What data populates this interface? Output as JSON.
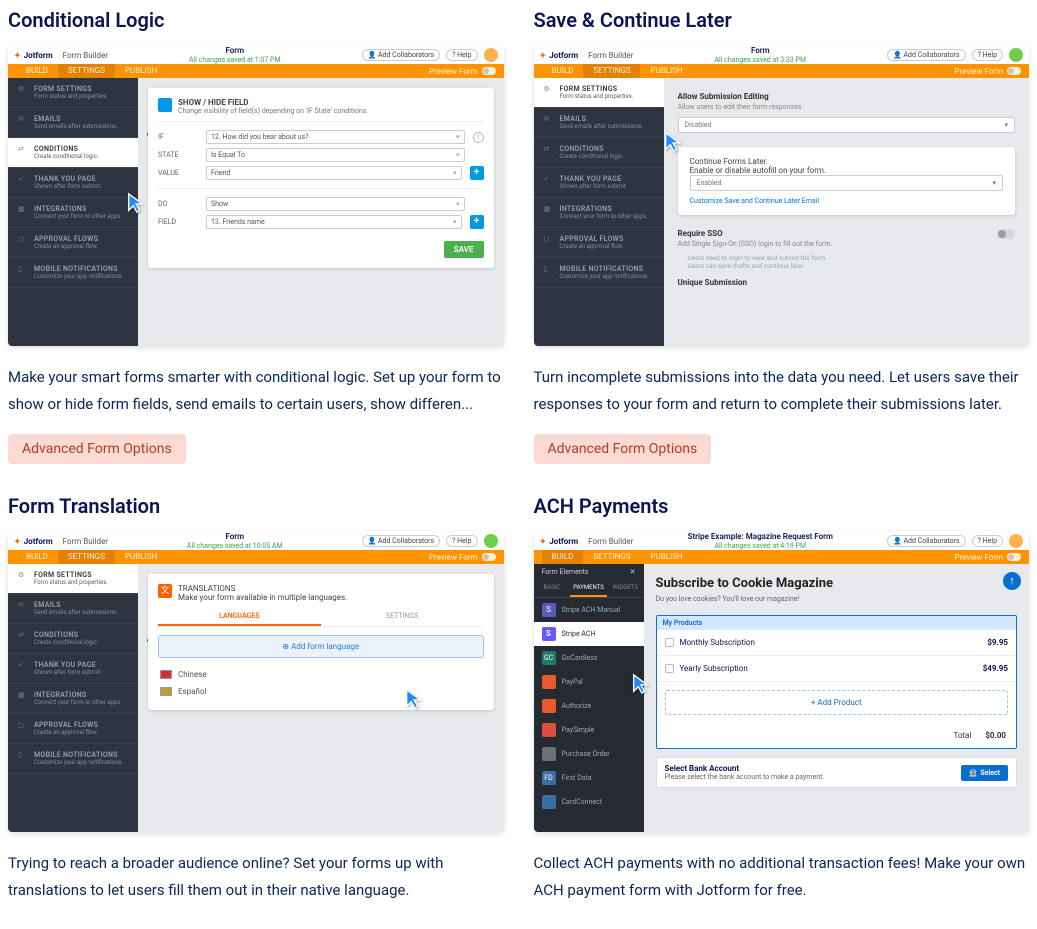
{
  "cards": {
    "conditional": {
      "title": "Conditional Logic",
      "desc": "Make your smart forms smarter with conditional logic. Set up your form to show or hide form fields, send emails to certain users, show differen...",
      "tag": "Advanced Form Options"
    },
    "savecontinue": {
      "title": "Save & Continue Later",
      "desc": "Turn incomplete submissions into the data you need. Let users save their responses to your form and return to complete their submissions later.",
      "tag": "Advanced Form Options"
    },
    "translation": {
      "title": "Form Translation",
      "desc": "Trying to reach a broader audience online? Set your forms up with translations to let users fill them out in their native language.",
      "tag": ""
    },
    "ach": {
      "title": "ACH Payments",
      "desc": "Collect ACH payments with no additional transaction fees! Make your own ACH payment form with Jotform for free.",
      "tag": ""
    }
  },
  "chrome": {
    "logo": "Jotform",
    "builder": "Form Builder",
    "form_title": "Form",
    "saved1": "All changes saved at 1:07 PM",
    "saved2": "All changes saved at 3:33 PM",
    "saved3": "All changes saved at 10:05 AM",
    "saved4": "All changes saved at 4:19 PM",
    "collab": "Add Collaborators",
    "help": "Help",
    "tabs": {
      "build": "BUILD",
      "settings": "SETTINGS",
      "publish": "PUBLISH"
    },
    "preview": "Preview Form"
  },
  "sidebar": {
    "items": [
      {
        "h": "FORM SETTINGS",
        "d": "Form status and properties."
      },
      {
        "h": "EMAILS",
        "d": "Send emails after submissions."
      },
      {
        "h": "CONDITIONS",
        "d": "Create conditional logic."
      },
      {
        "h": "THANK YOU PAGE",
        "d": "Shown after form submit."
      },
      {
        "h": "INTEGRATIONS",
        "d": "Connect your form to other apps."
      },
      {
        "h": "APPROVAL FLOWS",
        "d": "Create an approval flow."
      },
      {
        "h": "MOBILE NOTIFICATIONS",
        "d": "Customize your app notifications."
      }
    ]
  },
  "cond_panel": {
    "title": "SHOW / HIDE FIELD",
    "sub": "Change visibility of field(s) depending on 'IF State' conditions.",
    "if": "IF",
    "state": "STATE",
    "value": "VALUE",
    "do": "DO",
    "field": "FIELD",
    "if_v": "12. How did you hear about us?",
    "state_v": "Is Equal To",
    "value_v": "Friend",
    "do_v": "Show",
    "field_v": "13. Friends name",
    "save": "SAVE"
  },
  "save_panel": {
    "allow_h": "Allow Submission Editing",
    "allow_d": "Allow users to edit their form responses.",
    "allow_v": "Disabled",
    "cont_h": "Continue Forms Later",
    "cont_d": "Enable or disable autofill on your form.",
    "cont_v": "Enabled",
    "cont_link": "Customize Save and Continue Later Email",
    "sso_h": "Require SSO",
    "sso_d": "Add Single Sign-On (SSO) login to fill out the form.",
    "sso_n1": "Users need to login to view and submit the form.",
    "sso_n2": "Users can save drafts and continue later.",
    "uniq": "Unique Submission"
  },
  "trans_panel": {
    "title": "TRANSLATIONS",
    "sub": "Make your form available in multiple languages.",
    "tab1": "LANGUAGES",
    "tab2": "SETTINGS",
    "add": "Add form language",
    "l1": "Chinese",
    "l2": "Español"
  },
  "ach_shot": {
    "form_title": "Stripe Example: Magazine Request Form",
    "elements": "Form Elements",
    "tabs": {
      "basic": "BASIC",
      "payments": "PAYMENTS",
      "widgets": "WIDGETS"
    },
    "items": [
      {
        "label": "Stripe ACH Manual",
        "color": "#5b5bb9"
      },
      {
        "label": "Stripe ACH",
        "color": "#635bff"
      },
      {
        "label": "GoCardless",
        "color": "#1d7d6b"
      },
      {
        "label": "PayPal",
        "color": "#e65a2e"
      },
      {
        "label": "Authorize",
        "color": "#e65a2e"
      },
      {
        "label": "PaySimple",
        "color": "#d94f3d"
      },
      {
        "label": "Purchase Order",
        "color": "#6b6f78"
      },
      {
        "label": "First Data",
        "color": "#3b6ea5"
      },
      {
        "label": "CardConnect",
        "color": "#3b6ea5"
      }
    ],
    "h": "Subscribe to Cookie Magazine",
    "sub": "Do you love cookies? You'll love our magazine!",
    "myprod": "My Products",
    "p1": "Monthly Subscription",
    "p1p": "$9.95",
    "p2": "Yearly Subscription",
    "p2p": "$49.95",
    "addp": "+ Add Product",
    "total": "Total",
    "totv": "$0.00",
    "bank_h": "Select Bank Account",
    "bank_d": "Please select the bank account to make a payment.",
    "select": "Select"
  }
}
